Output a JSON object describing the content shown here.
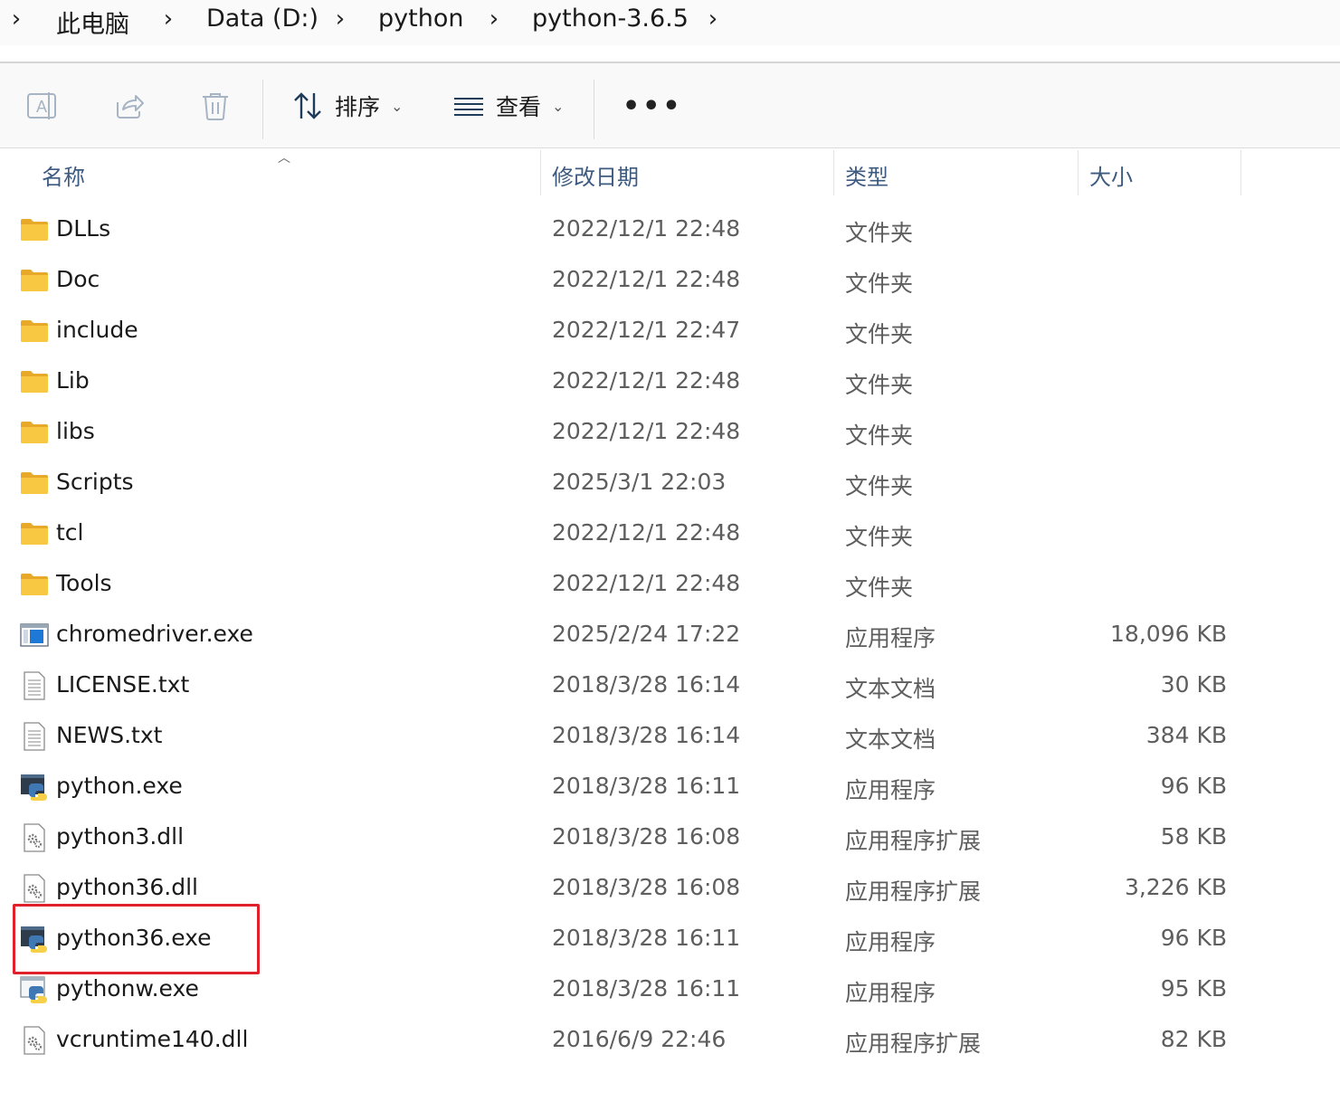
{
  "breadcrumb": {
    "items": [
      "此电脑",
      "Data (D:)",
      "python",
      "python-3.6.5"
    ]
  },
  "toolbar": {
    "rename_icon": "rename-icon",
    "share_icon": "share-icon",
    "delete_icon": "delete-icon",
    "sort_label": "排序",
    "view_label": "查看",
    "more_label": "•••"
  },
  "columns": {
    "name": "名称",
    "date": "修改日期",
    "type": "类型",
    "size": "大小"
  },
  "files": [
    {
      "name": "DLLs",
      "date": "2022/12/1 22:48",
      "type": "文件夹",
      "size": "",
      "icon": "folder-icon"
    },
    {
      "name": "Doc",
      "date": "2022/12/1 22:48",
      "type": "文件夹",
      "size": "",
      "icon": "folder-icon"
    },
    {
      "name": "include",
      "date": "2022/12/1 22:47",
      "type": "文件夹",
      "size": "",
      "icon": "folder-icon"
    },
    {
      "name": "Lib",
      "date": "2022/12/1 22:48",
      "type": "文件夹",
      "size": "",
      "icon": "folder-icon"
    },
    {
      "name": "libs",
      "date": "2022/12/1 22:48",
      "type": "文件夹",
      "size": "",
      "icon": "folder-icon"
    },
    {
      "name": "Scripts",
      "date": "2025/3/1 22:03",
      "type": "文件夹",
      "size": "",
      "icon": "folder-icon"
    },
    {
      "name": "tcl",
      "date": "2022/12/1 22:48",
      "type": "文件夹",
      "size": "",
      "icon": "folder-icon"
    },
    {
      "name": "Tools",
      "date": "2022/12/1 22:48",
      "type": "文件夹",
      "size": "",
      "icon": "folder-icon"
    },
    {
      "name": "chromedriver.exe",
      "date": "2025/2/24 17:22",
      "type": "应用程序",
      "size": "18,096 KB",
      "icon": "app-window-icon"
    },
    {
      "name": "LICENSE.txt",
      "date": "2018/3/28 16:14",
      "type": "文本文档",
      "size": "30 KB",
      "icon": "text-file-icon"
    },
    {
      "name": "NEWS.txt",
      "date": "2018/3/28 16:14",
      "type": "文本文档",
      "size": "384 KB",
      "icon": "text-file-icon"
    },
    {
      "name": "python.exe",
      "date": "2018/3/28 16:11",
      "type": "应用程序",
      "size": "96 KB",
      "icon": "python-exe-icon"
    },
    {
      "name": "python3.dll",
      "date": "2018/3/28 16:08",
      "type": "应用程序扩展",
      "size": "58 KB",
      "icon": "dll-gear-icon"
    },
    {
      "name": "python36.dll",
      "date": "2018/3/28 16:08",
      "type": "应用程序扩展",
      "size": "3,226 KB",
      "icon": "dll-gear-icon"
    },
    {
      "name": "python36.exe",
      "date": "2018/3/28 16:11",
      "type": "应用程序",
      "size": "96 KB",
      "icon": "python-exe-icon"
    },
    {
      "name": "pythonw.exe",
      "date": "2018/3/28 16:11",
      "type": "应用程序",
      "size": "95 KB",
      "icon": "python-window-icon"
    },
    {
      "name": "vcruntime140.dll",
      "date": "2016/6/9 22:46",
      "type": "应用程序扩展",
      "size": "82 KB",
      "icon": "dll-gear-icon"
    }
  ],
  "highlight": {
    "color": "#e0202a"
  },
  "colors": {
    "folder": "#f5c342",
    "header_text": "#3d5a80"
  }
}
